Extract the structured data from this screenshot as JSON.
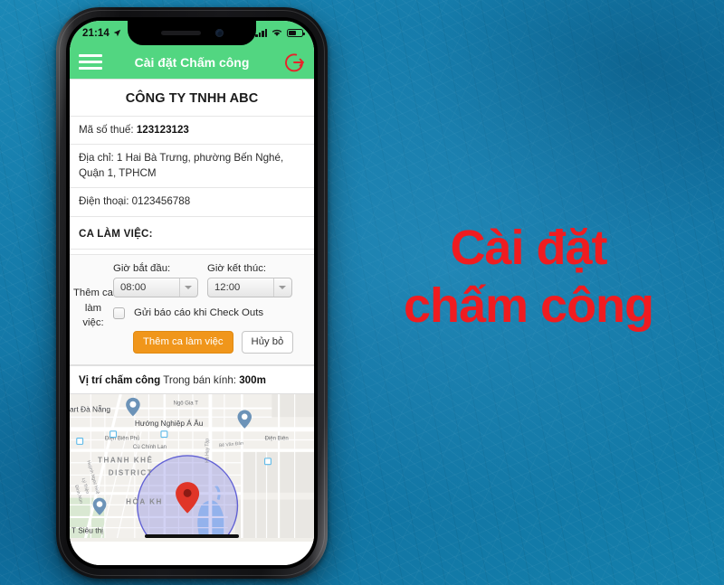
{
  "headline": {
    "line1": "Cài đặt",
    "line2": "chấm công",
    "color": "#f01c20"
  },
  "phone": {
    "status_bar": {
      "time": "21:14",
      "location_icon": "location-arrow-icon",
      "signal_icon": "cellular-signal-icon",
      "wifi_icon": "wifi-icon",
      "battery_icon": "battery-icon"
    },
    "app_bar": {
      "menu_icon": "hamburger-menu-icon",
      "title": "Cài đặt Chấm công",
      "logout_icon": "logout-icon",
      "bg_color": "#52d681",
      "logout_color": "#e8222a"
    }
  },
  "company": {
    "name": "CÔNG TY TNHH ABC",
    "rows": [
      {
        "label": "Mã số thuế:",
        "value": "123123123",
        "bold_value": true
      },
      {
        "label": "Địa chỉ:",
        "value": "1 Hai Bà Trưng, phường Bến Nghé, Quận 1, TPHCM",
        "bold_value": false
      },
      {
        "label": "Điện thoại:",
        "value": "0123456788",
        "bold_value": false
      }
    ]
  },
  "shift": {
    "section_title": "CA LÀM VIỆC:",
    "row_label": "Thêm ca làm việc:",
    "start_label": "Giờ bắt đầu:",
    "start_value": "08:00",
    "end_label": "Giờ kết thúc:",
    "end_value": "12:00",
    "checkbox_label": "Gửi báo cáo khi Check Outs",
    "checkbox_checked": false,
    "submit_label": "Thêm ca làm việc",
    "cancel_label": "Hủy bỏ",
    "submit_color": "#f0961b"
  },
  "location": {
    "title": "Vị trí chấm công",
    "radius_label": "Trong bán kính:",
    "radius_value": "300m",
    "map": {
      "district_label": "THANH KHÊ DISTRICT",
      "ward_label": "HÒA KH",
      "places": [
        {
          "name": "art Đà Nẵng",
          "kind": "store-marker"
        },
        {
          "name": "Hướng Nghiệp Á Âu",
          "kind": "place-marker"
        },
        {
          "name": "T Siêu thị",
          "kind": "store-marker"
        }
      ],
      "streets": [
        "Ngô Gia T",
        "Điện Biên Phủ",
        "Điện Biên",
        "Cù Chính Lan",
        "Bế Văn Đàn",
        "Hà Huy Tập",
        "Huỳnh Ngọc Huệ",
        "Lý Triện",
        "Đinh Nùn"
      ],
      "radius_circle_color": "#4c4ccf",
      "pin_color": "#e03528"
    }
  }
}
